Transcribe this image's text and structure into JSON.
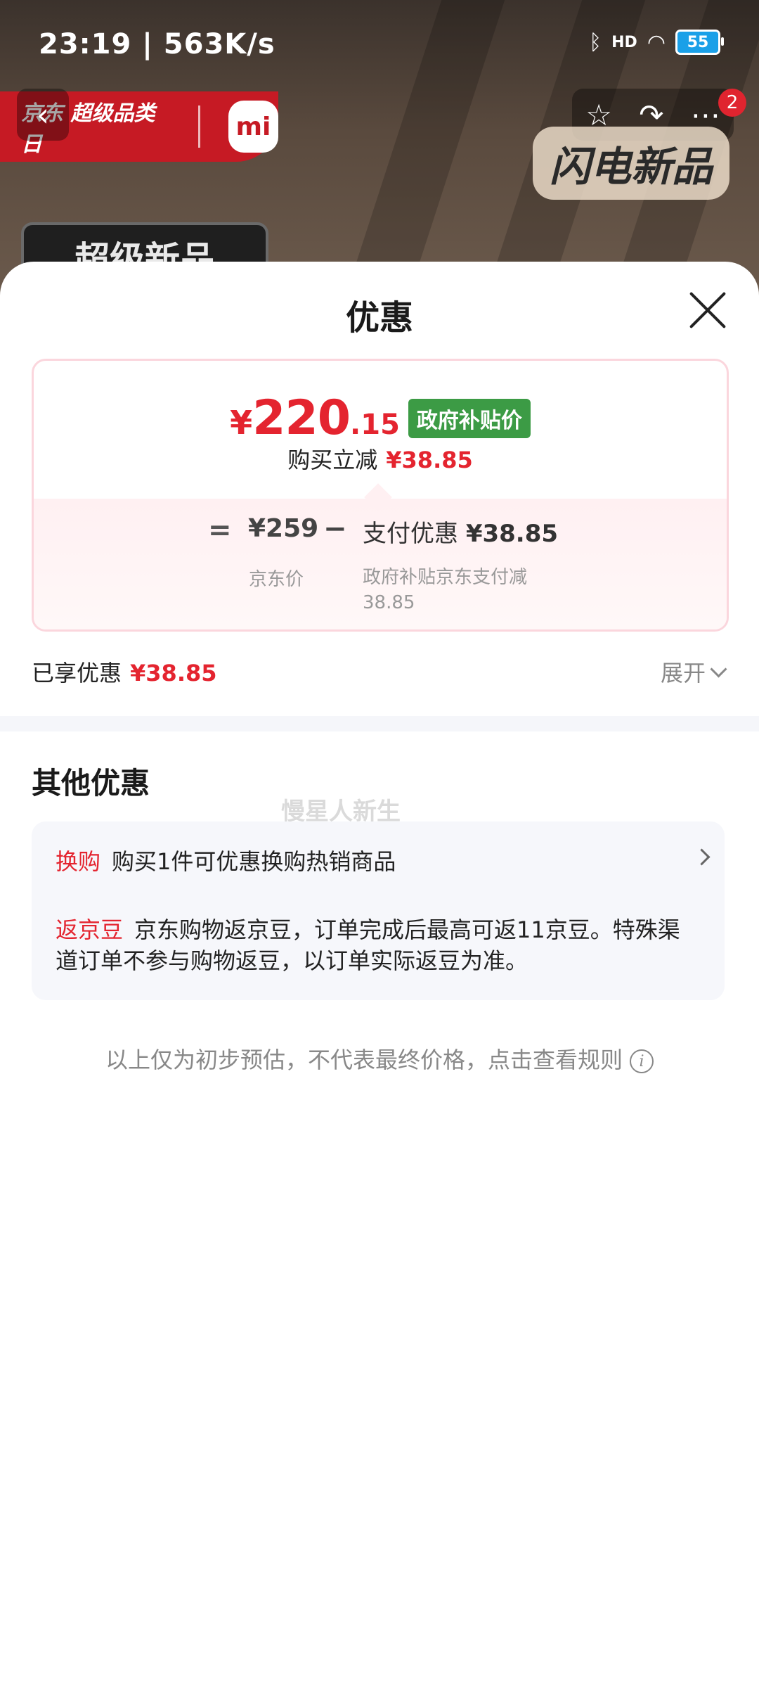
{
  "status_bar": {
    "time": "23:19 | 563K/s",
    "battery": "55",
    "signal_text": "HD"
  },
  "header": {
    "brand_text": "京东 超级品类日",
    "mi_logo": "mi",
    "flash_label": "闪电新品",
    "super_new": "超级新品",
    "badge_count": "2"
  },
  "sheet": {
    "title": "优惠",
    "price_card": {
      "currency": "¥",
      "price_int": "220",
      "price_dec": ".15",
      "gov_tag": "政府补贴价",
      "instant_label": "购买立减",
      "instant_amount": "¥38.85",
      "eq": "=",
      "jd_price": "¥259",
      "minus": "−",
      "pay_label": "支付优惠",
      "pay_amount": "¥38.85",
      "jd_price_caption": "京东价",
      "pay_caption": "政府补贴京东支付减38.85"
    },
    "enjoyed_label": "已享优惠",
    "enjoyed_amount": "¥38.85",
    "expand_label": "展开"
  },
  "other": {
    "title": "其他优惠",
    "watermark": "慢星人新生",
    "offers": [
      {
        "tag": "换购",
        "text": "购买1件可优惠换购热销商品"
      },
      {
        "tag": "返京豆",
        "text": "京东购物返京豆，订单完成后最高可返11京豆。特殊渠道订单不参与购物返豆，以订单实际返豆为准。"
      }
    ],
    "disclaimer": "以上仅为初步预估，不代表最终价格，点击查看规则"
  },
  "colors": {
    "accent_red": "#e4242f",
    "gov_green": "#3c9b45",
    "banner_red": "#c61a24"
  }
}
